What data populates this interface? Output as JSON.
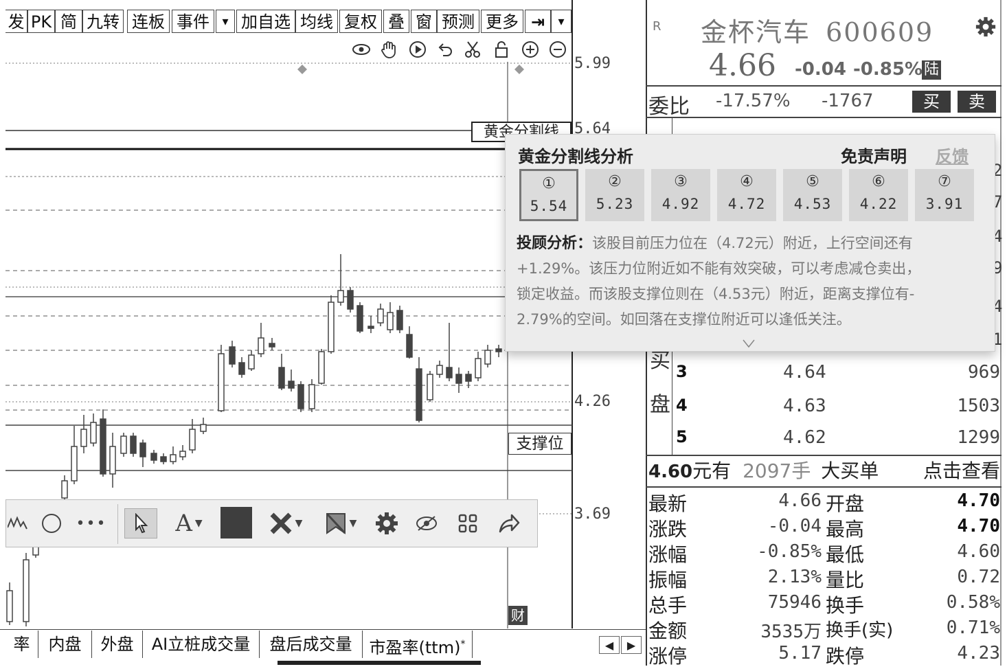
{
  "toolbar": {
    "items": [
      "发",
      "PK",
      "简",
      "九转",
      "连板",
      "事件",
      "▾",
      "加自选",
      "均线",
      "复权",
      "叠",
      "窗",
      "预测",
      "更多",
      "⇥",
      "▾"
    ]
  },
  "chart_tools": [
    "eye-icon",
    "hand-icon",
    "play-icon",
    "undo-icon",
    "scissors-icon",
    "lock-icon",
    "zoom-in-icon",
    "zoom-out-icon"
  ],
  "price_axis": {
    "labels": [
      "5.99",
      "5.64",
      "4.26",
      "3.69"
    ]
  },
  "chart_labels": {
    "golden_line": "黄金分割线",
    "support": "支撑位",
    "fin": "财"
  },
  "stock": {
    "r_mark": "R",
    "name": "金杯汽车",
    "code": "600609",
    "price": "4.66",
    "change": "-0.04",
    "change_pct": "-0.85%",
    "market_tag": "陆",
    "wei_label": "委比",
    "wei_pct": "-17.57%",
    "wei_diff": "-1767",
    "buy_btn": "买",
    "sell_btn": "卖"
  },
  "popup": {
    "title": "黄金分割线分析",
    "disclaimer": "免责声明",
    "feedback": "反馈",
    "levels": [
      {
        "num": "①",
        "value": "5.54"
      },
      {
        "num": "②",
        "value": "5.23"
      },
      {
        "num": "③",
        "value": "4.92"
      },
      {
        "num": "④",
        "value": "4.72"
      },
      {
        "num": "⑤",
        "value": "4.53"
      },
      {
        "num": "⑥",
        "value": "4.22"
      },
      {
        "num": "⑦",
        "value": "3.91"
      }
    ],
    "analysis_label": "投顾分析：",
    "analysis_l1": "该股目前压力位在（4.72元）附近，上行空间还有",
    "analysis_l2": "+1.29%。该压力位附近如不能有效突破，可以考虑减仓卖出，",
    "analysis_l3": "锁定收益。而该股支撑位则在（4.53元）附近，距离支撑位有-",
    "analysis_l4": "2.79%的空间。如回落在支撑位附近可以逢低关注。"
  },
  "order_book": {
    "side_label_1": "买",
    "side_label_2": "盘",
    "rows": [
      {
        "level": "3",
        "price": "4.64",
        "vol": "969"
      },
      {
        "level": "4",
        "price": "4.63",
        "vol": "1503"
      },
      {
        "level": "5",
        "price": "4.62",
        "vol": "1299"
      }
    ],
    "right_edge_digits": [
      "1",
      "2",
      "7",
      "4",
      "9",
      "4",
      "1"
    ]
  },
  "big_order": {
    "price": "4.60",
    "text1": "元有",
    "vol": "2097手",
    "text2": "大买单",
    "link": "点击查看"
  },
  "quote_stats": [
    {
      "l1": "最新",
      "v1": "4.66",
      "l2": "开盘",
      "v2": "4.70"
    },
    {
      "l1": "涨跌",
      "v1": "-0.04",
      "l2": "最高",
      "v2": "4.70"
    },
    {
      "l1": "涨幅",
      "v1": "-0.85%",
      "l2": "最低",
      "v2": "4.60"
    },
    {
      "l1": "振幅",
      "v1": "2.13%",
      "l2": "量比",
      "v2": "0.72"
    },
    {
      "l1": "总手",
      "v1": "75946",
      "l2": "换手",
      "v2": "0.58%"
    },
    {
      "l1": "金额",
      "v1": "3535万",
      "l2": "换手(实)",
      "v2": "0.71%"
    },
    {
      "l1": "涨停",
      "v1": "5.17",
      "l2": "跌停",
      "v2": "4.23"
    }
  ],
  "bottom_tabs": [
    "率",
    "内盘",
    "外盘",
    "AI立桩成交量",
    "盘后成交量",
    "市盈率(ttm)"
  ],
  "bottom_tab_mark": "*",
  "nav": {
    "left": "◀",
    "right": "▶"
  },
  "draw_tools": [
    "wave-icon",
    "circle-icon",
    "more-icon",
    "pointer-icon",
    "text-icon",
    "color-swatch",
    "delete-icon",
    "no-mark-icon",
    "gear-icon",
    "eye-off-icon",
    "grid-icon",
    "share-icon"
  ]
}
